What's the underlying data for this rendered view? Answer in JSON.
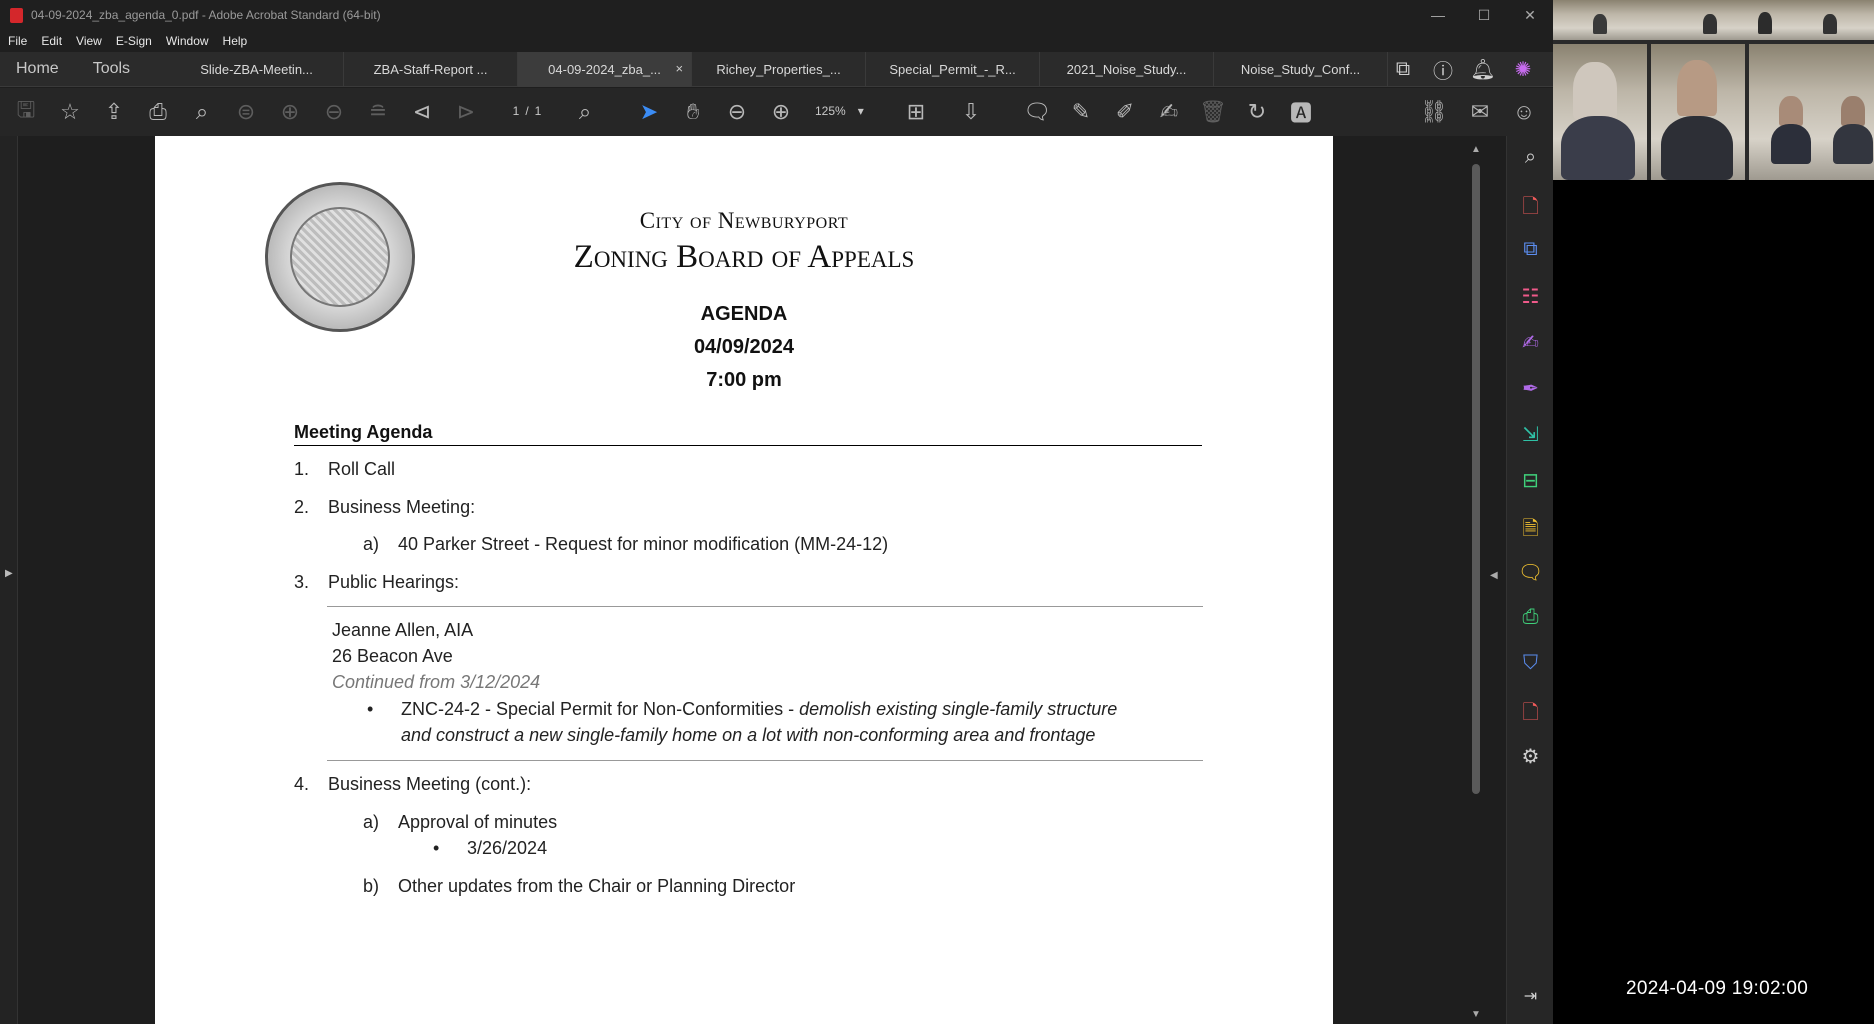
{
  "window": {
    "title": "04-09-2024_zba_agenda_0.pdf - Adobe Acrobat Standard (64-bit)",
    "minimize": "—",
    "maximize": "☐",
    "close": "✕"
  },
  "menu": [
    "File",
    "Edit",
    "View",
    "E-Sign",
    "Window",
    "Help"
  ],
  "nav_tabs": [
    "Home",
    "Tools"
  ],
  "doc_tabs": [
    {
      "label": "Slide-ZBA-Meetin..."
    },
    {
      "label": "ZBA-Staff-Report ..."
    },
    {
      "label": "04-09-2024_zba_...",
      "close": "×"
    },
    {
      "label": "Richey_Properties_..."
    },
    {
      "label": "Special_Permit_-_R..."
    },
    {
      "label": "2021_Noise_Study..."
    },
    {
      "label": "Noise_Study_Conf..."
    }
  ],
  "tab_icons": [
    "share-screen-icon",
    "help-icon",
    "bell-icon",
    "ai-assistant-icon"
  ],
  "toolbar": {
    "page_current": "1",
    "page_sep": "/",
    "page_total": "1",
    "zoom": "125%",
    "zoom_caret": "▾"
  },
  "document": {
    "city": "City of Newburyport",
    "board": "Zoning Board of Appeals",
    "agenda": "AGENDA",
    "date": "04/09/2024",
    "time": "7:00 pm",
    "section_title": "Meeting Agenda",
    "items": {
      "i1_num": "1.",
      "i1_text": "Roll Call",
      "i2_num": "2.",
      "i2_text": "Business Meeting:",
      "i2a_letter": "a)",
      "i2a_text": "40 Parker Street - Request for minor modification (MM-24-12)",
      "i3_num": "3.",
      "i3_text": "Public Hearings:",
      "applicant": "Jeanne Allen, AIA",
      "address": "26 Beacon Ave",
      "continued": "Continued from 3/12/2024",
      "bullet": "•",
      "permit_label": "ZNC-24-2 - Special Permit for Non-Conformities - ",
      "permit_desc_1": "demolish existing single-family structure",
      "permit_desc_2": "and construct a new single-family home on a lot with non-conforming area and frontage",
      "i4_num": "4.",
      "i4_text": "Business Meeting (cont.):",
      "i4a_letter": "a)",
      "i4a_text": "Approval of minutes",
      "i4a_bullet_text": "3/26/2024",
      "i4b_letter": "b)",
      "i4b_text": "Other updates from the Chair or Planning Director"
    }
  },
  "video": {
    "timestamp": "2024-04-09 19:02:00"
  },
  "colors": {
    "accent_blue": "#3b8cf5",
    "pdf_red": "#d4272b"
  }
}
